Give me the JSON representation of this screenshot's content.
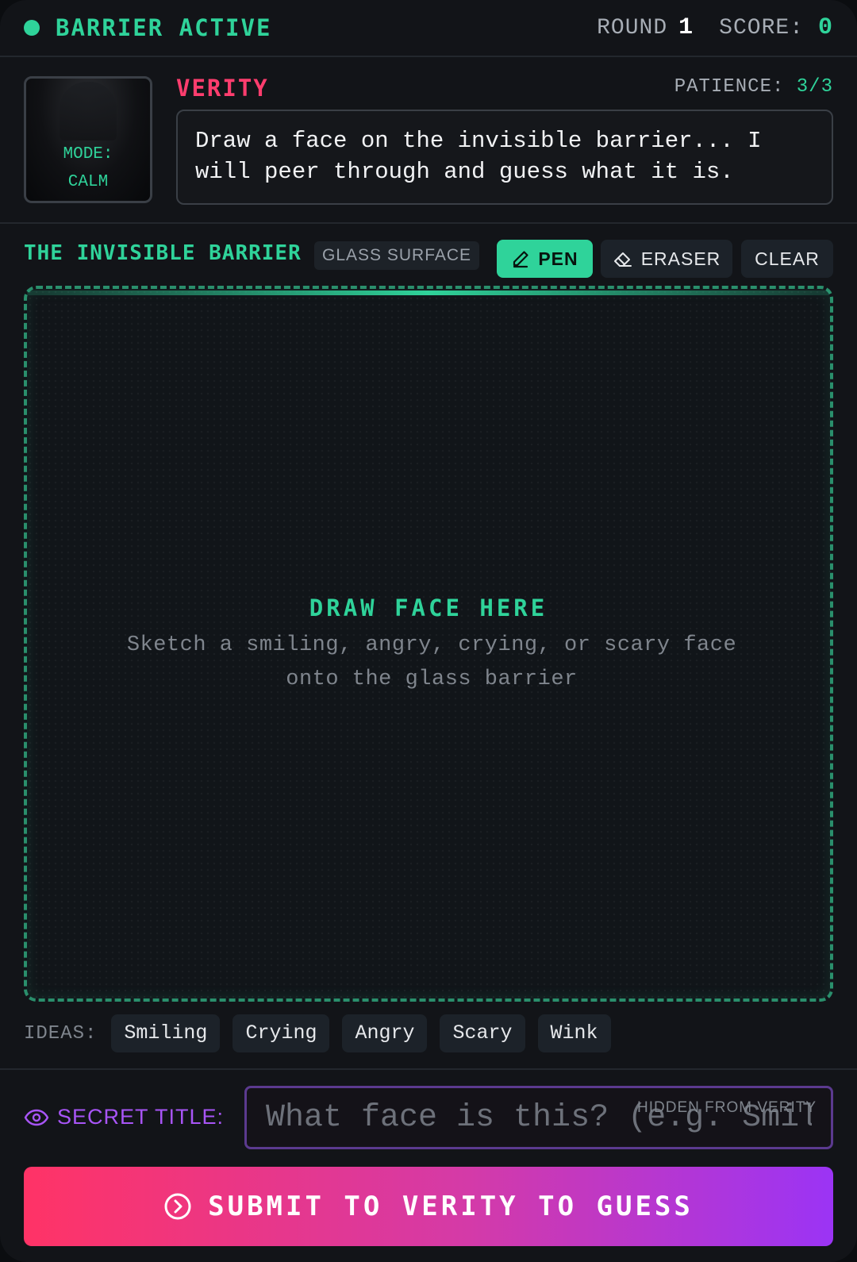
{
  "header": {
    "status": "BARRIER ACTIVE",
    "round_label": "ROUND",
    "round": "1",
    "score_label": "SCORE:",
    "score": "0"
  },
  "character": {
    "name": "VERITY",
    "mode_label": "MODE:",
    "mode": "CALM",
    "patience_label": "PATIENCE:",
    "patience": "3/3",
    "speech": "Draw a face on the invisible barrier... I will peer through and guess what it is."
  },
  "barrier": {
    "title": "THE INVISIBLE BARRIER",
    "surface_tag": "GLASS SURFACE",
    "tools": {
      "pen": "PEN",
      "eraser": "ERASER",
      "clear": "CLEAR",
      "active": "pen"
    },
    "canvas_title": "DRAW FACE HERE",
    "canvas_hint": "Sketch a smiling, angry, crying, or scary face onto the glass barrier"
  },
  "ideas": {
    "label": "IDEAS:",
    "items": [
      "Smiling",
      "Crying",
      "Angry",
      "Scary",
      "Wink"
    ]
  },
  "secret": {
    "label": "SECRET TITLE:",
    "placeholder": "What face is this? (e.g. Smiling)",
    "value": "",
    "note": "HIDDEN FROM VERITY"
  },
  "submit": {
    "label": "SUBMIT TO VERITY TO GUESS"
  },
  "colors": {
    "accent": "#2fd39a",
    "danger": "#ff3d6e",
    "secret": "#a855f7",
    "submit_gradient_start": "#ff3366",
    "submit_gradient_end": "#9b34f5"
  },
  "icons": {
    "pen": "pencil-icon",
    "eraser": "eraser-icon",
    "secret": "eye-icon",
    "submit": "circle-arrow-right-icon"
  }
}
